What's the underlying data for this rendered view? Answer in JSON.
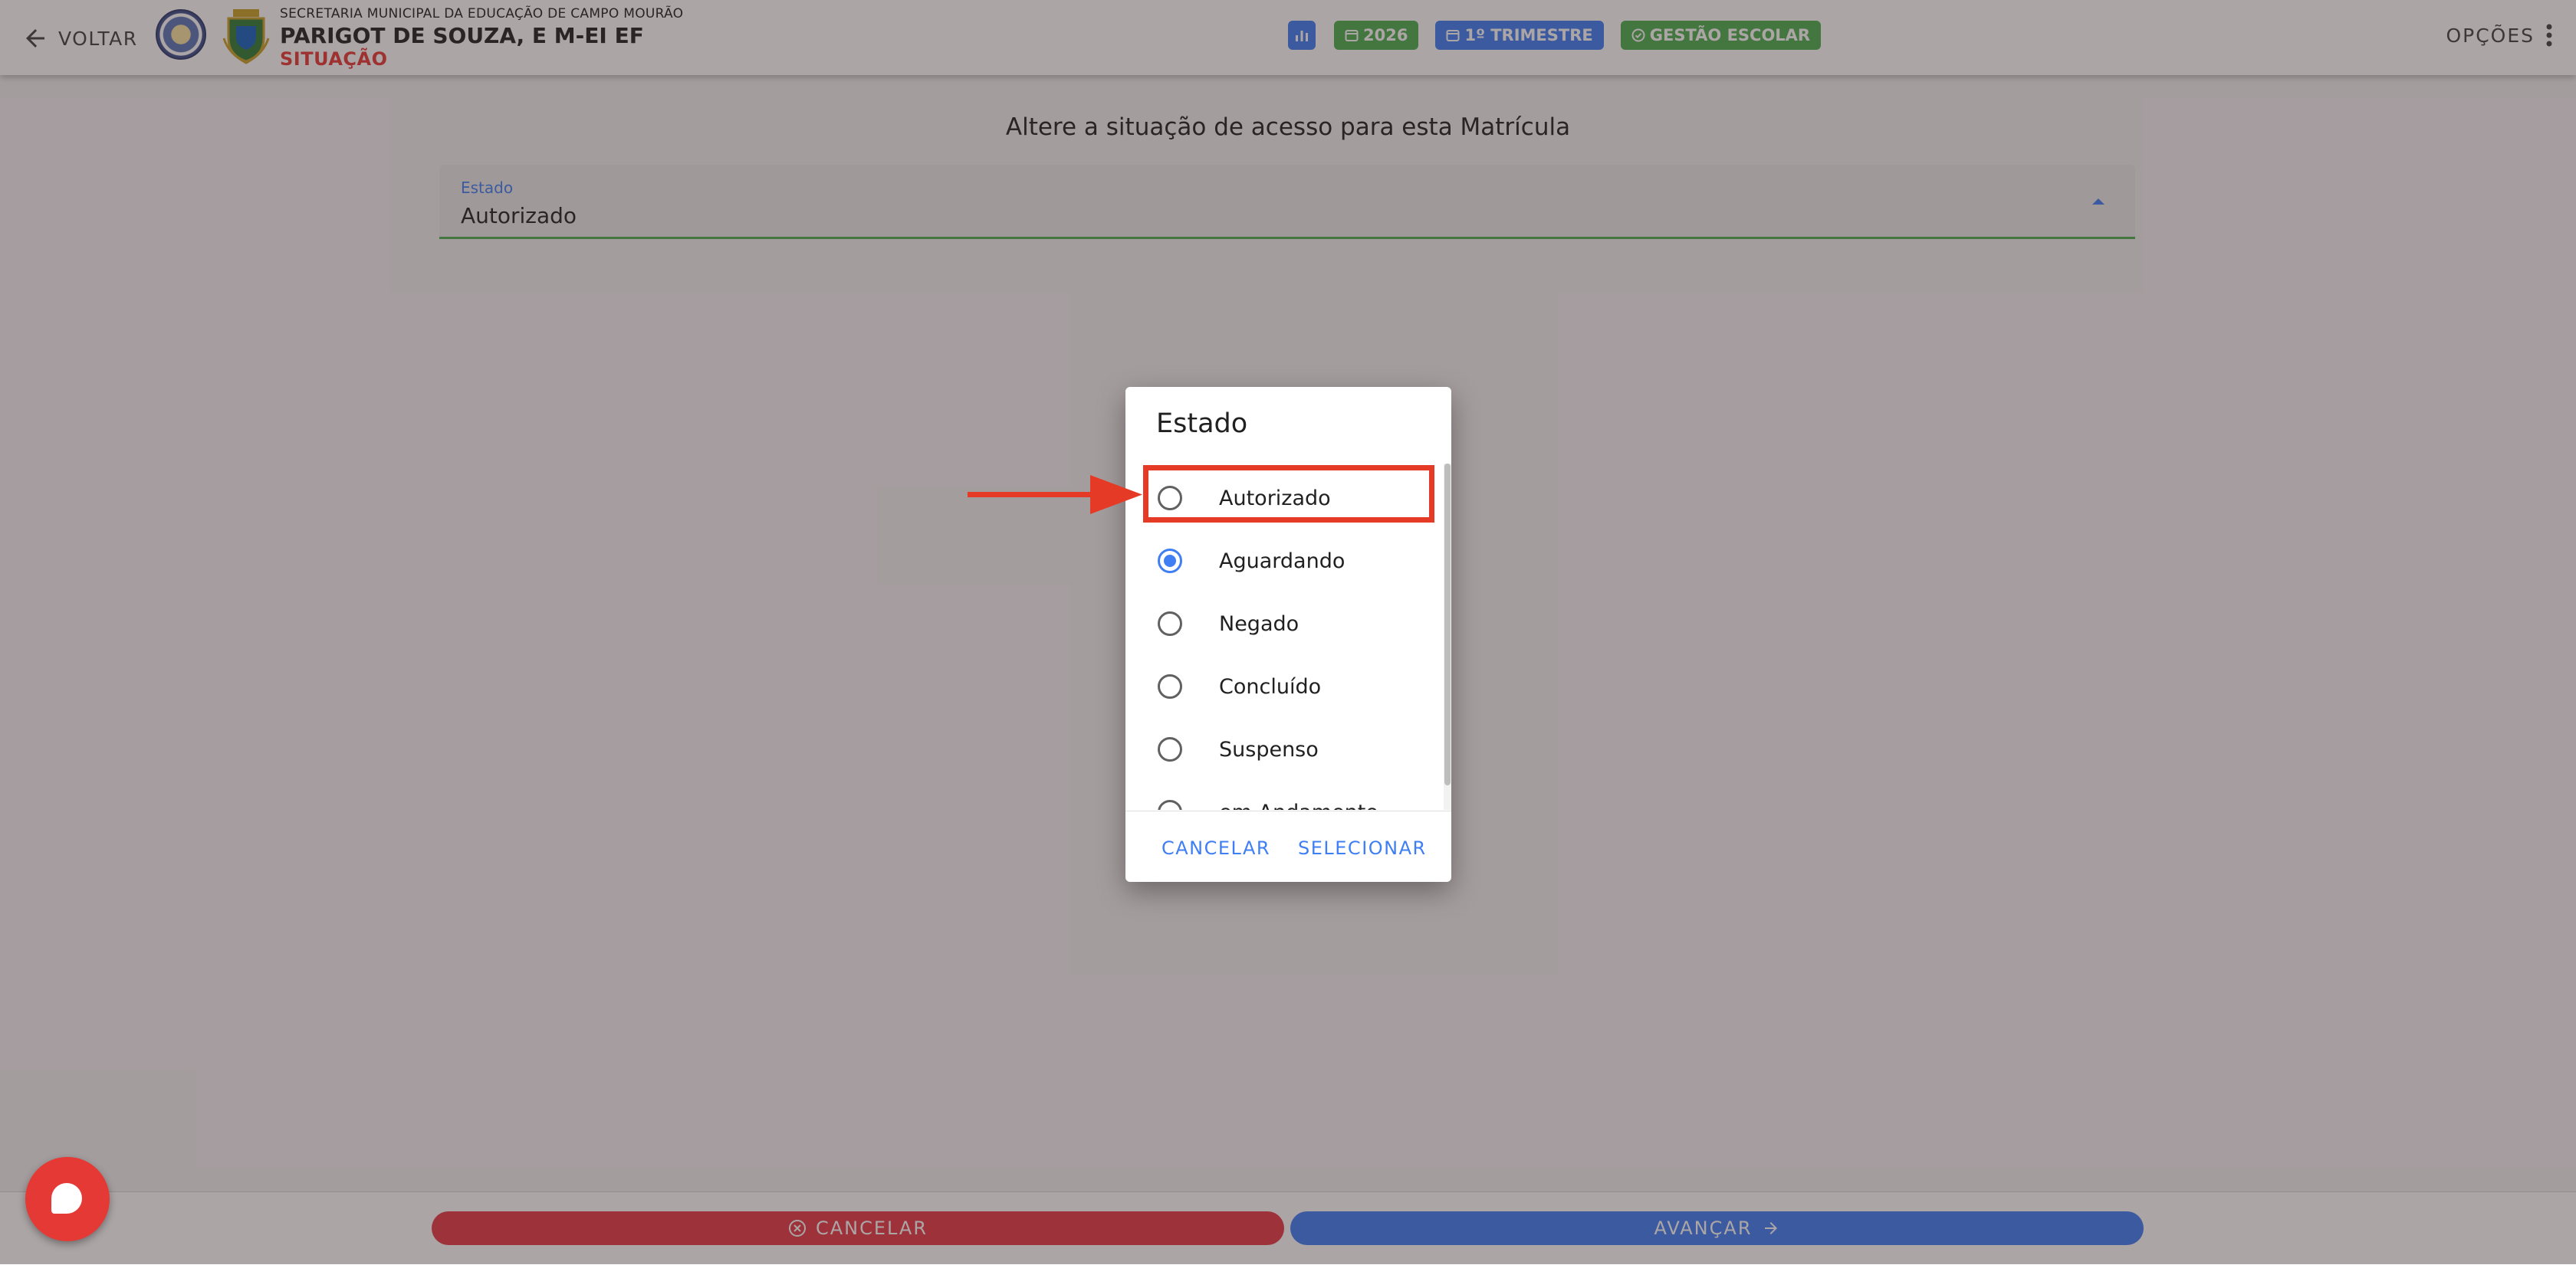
{
  "header": {
    "back_label": "VOLTAR",
    "subtitle": "SECRETARIA MUNICIPAL DA EDUCAÇÃO DE CAMPO MOURÃO",
    "school_name": "PARIGOT DE SOUZA, E M-EI EF",
    "section": "SITUAÇÃO",
    "chips": {
      "year": "2026",
      "term": "1º TRIMESTRE",
      "module": "GESTÃO ESCOLAR"
    },
    "options_label": "OPÇÕES"
  },
  "content": {
    "heading": "Altere a situação de acesso para esta Matrícula",
    "select": {
      "label": "Estado",
      "value": "Autorizado"
    }
  },
  "dialog": {
    "title": "Estado",
    "options": [
      {
        "label": "Autorizado",
        "selected": false
      },
      {
        "label": "Aguardando",
        "selected": true
      },
      {
        "label": "Negado",
        "selected": false
      },
      {
        "label": "Concluído",
        "selected": false
      },
      {
        "label": "Suspenso",
        "selected": false
      },
      {
        "label": "em Andamento",
        "selected": false
      }
    ],
    "cancel_label": "CANCELAR",
    "select_label": "SELECIONAR"
  },
  "footer": {
    "cancel_label": "CANCELAR",
    "next_label": "AVANÇAR"
  },
  "colors": {
    "primary": "#3f7ff3",
    "success": "#4caf50",
    "danger": "#e53935",
    "annotation": "#e53a25"
  }
}
